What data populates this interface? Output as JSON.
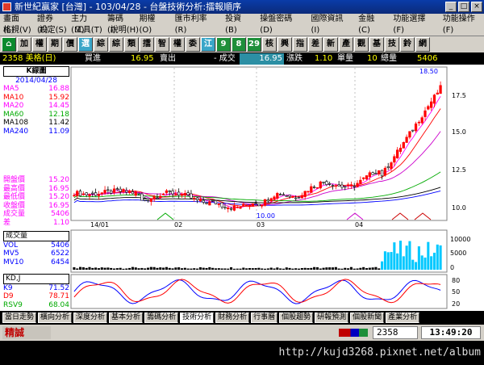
{
  "window": {
    "title": "新世紀贏家 [台灣] - 103/04/28 - 台盤技術分析:擂報順序",
    "controls": [
      "_",
      "□",
      "×"
    ]
  },
  "menu": {
    "row1": [
      "畫面(L)",
      "證券(F)",
      "主力(M)",
      "籌碼(I)",
      "期權(O)",
      "匯市利率(R)",
      "投資(B)",
      "操盤密碼(D)",
      "國際資訊(I)",
      "金融(C)",
      "功能選擇(F)",
      "功能操作(F)"
    ],
    "row2": [
      "格視(V)",
      "設定(S)",
      "工具(T)",
      "說明(H)"
    ]
  },
  "toolbar": {
    "buttons": [
      "⌂",
      "加",
      "權",
      "期",
      "價",
      "選",
      "綜",
      "綜",
      "類",
      "擂",
      "智",
      "權",
      "委",
      "江",
      "9",
      "8",
      "29",
      "核",
      "興",
      "指",
      "差",
      "新",
      "產",
      "觀",
      "基",
      "技",
      "鈴",
      "網"
    ]
  },
  "info": {
    "stock": "2358 美格(日)",
    "buy_label": "買進",
    "buy_value": "16.95",
    "sell_label": "賣出",
    "trade_label": "- 成交",
    "trade_value": "16.95",
    "change_label": "漲跌",
    "change_value": "1.10",
    "volume_label": "單量",
    "volume_value": "10",
    "total_label": "總量",
    "total_value": "5406"
  },
  "price_panel": {
    "title": "K線圖",
    "date": "2014/04/28",
    "ma": [
      {
        "label": "MA5",
        "value": "16.88",
        "color": "#ff00ff"
      },
      {
        "label": "MA10",
        "value": "15.92",
        "color": "#ff0000"
      },
      {
        "label": "MA20",
        "value": "14.45",
        "color": "#ff00ff"
      },
      {
        "label": "MA60",
        "value": "12.18",
        "color": "#00aa00"
      },
      {
        "label": "MA108",
        "value": "11.42",
        "color": "#000000"
      },
      {
        "label": "MA240",
        "value": "11.09",
        "color": "#0000ff"
      }
    ],
    "ohlc": [
      {
        "label": "開盤價",
        "value": "15.20"
      },
      {
        "label": "最高價",
        "value": "16.95"
      },
      {
        "label": "最低價",
        "value": "15.20"
      },
      {
        "label": "收盤價",
        "value": "16.95"
      },
      {
        "label": "成交量",
        "value": "5406"
      },
      {
        "label": "差",
        "value": "1.10"
      }
    ],
    "high_mark": "18.50",
    "low_mark": "10.00",
    "yticks": [
      "17.5",
      "15.0",
      "12.5",
      "10.0"
    ],
    "xticks": [
      "14/01",
      "02",
      "03",
      "04"
    ]
  },
  "volume_panel": {
    "title": "成交量",
    "items": [
      {
        "label": "VOL",
        "value": "5406"
      },
      {
        "label": "MV5",
        "value": "6522"
      },
      {
        "label": "MV10",
        "value": "6454"
      }
    ],
    "yticks": [
      "10000",
      "5000",
      "0"
    ]
  },
  "kd_panel": {
    "title": "KD,J",
    "items": [
      {
        "label": "K9",
        "value": "71.52",
        "color": "#0000ff"
      },
      {
        "label": "D9",
        "value": "78.71",
        "color": "#ff0000"
      },
      {
        "label": "RSV9",
        "value": "68.04",
        "color": "#00aa00"
      }
    ],
    "yticks": [
      "80",
      "50",
      "20"
    ]
  },
  "tabs": [
    "當日走勢",
    "橫向分析",
    "深度分析",
    "基本分析",
    "籌碼分析",
    "技術分析",
    "財務分析",
    "行事曆",
    "個股趨勢",
    "研報預測",
    "個股新聞",
    "產業分析"
  ],
  "active_tab": "技術分析",
  "status": {
    "mode": "精誠",
    "symbol": "2358",
    "time": "13:49:20"
  },
  "watermark": "http://kujd3268.pixnet.net/album",
  "colors": {
    "up": "#ff0000",
    "down": "#00cc00",
    "volume": "#00c8ff",
    "background": "#ffffff",
    "panel_bg": "#000000"
  }
}
